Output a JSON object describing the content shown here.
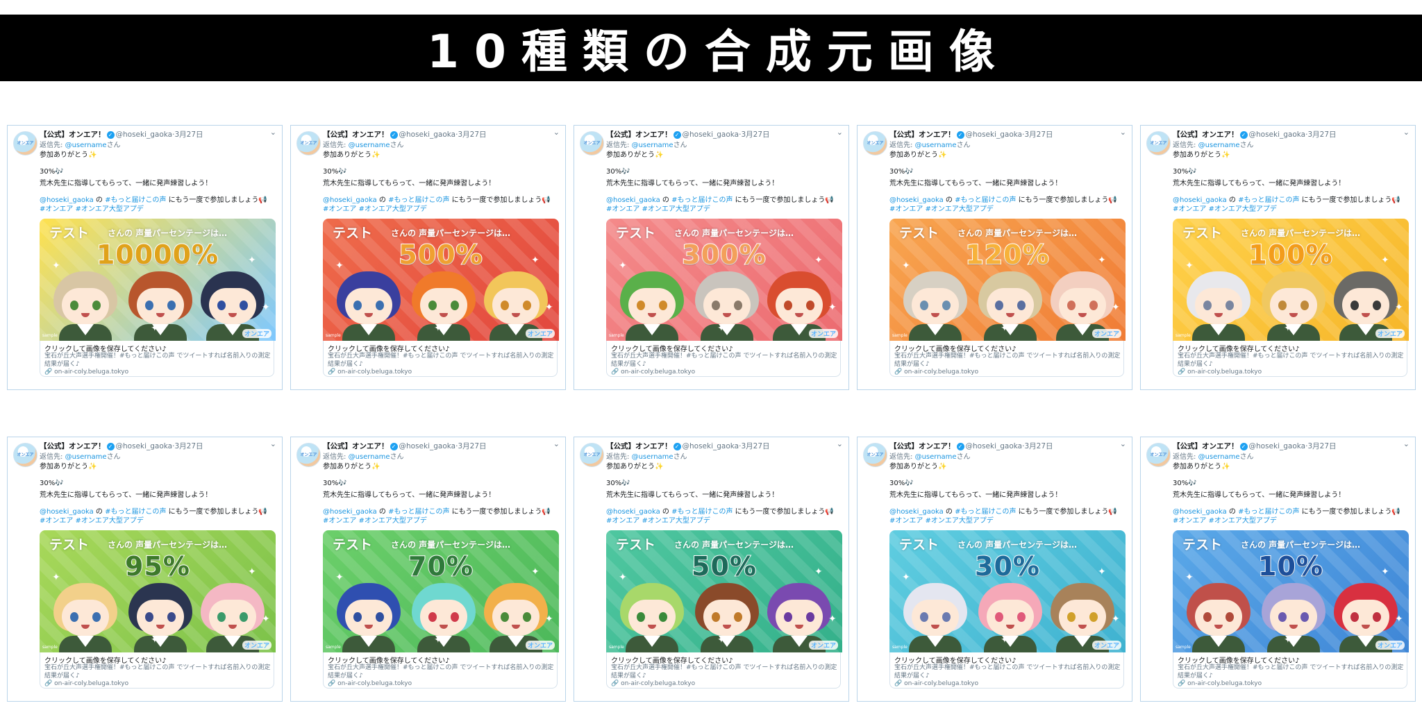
{
  "banner": {
    "title": "10種類の合成元画像"
  },
  "tweet": {
    "display_name": "【公式】オンエア！",
    "verified_glyph": "✓",
    "handle": "@hoseki_gaoka",
    "separator": "·",
    "date": "3月27日",
    "menu_glyph": "⌄",
    "reply_prefix": "返信先: ",
    "reply_user": "@username",
    "reply_suffix": "さん",
    "thanks": "参加ありがとう✨",
    "percent_line": "30%🎶",
    "coach_line": "荒木先生に指導してもらって、一緒に発声練習しよう！",
    "mention": "@hoseki_gaoka",
    "mention_mid": " の ",
    "hashtag_main": "#もっと届けこの声",
    "invite": " にもう一度で参加しましょう📢",
    "hashtags": "#オンエア #オンエア大型アプデ",
    "avatar_text": "オンエア",
    "banner_test": "テスト",
    "banner_sub": "さんの 声量パーセンテージは…",
    "banner_brand": "オンエア",
    "banner_mark": "sample",
    "card_title": "クリックして画像を保存してください♪",
    "card_desc": "宝石が丘大声選手権開催！#もっと届けこの声 でツイートすれば名前入りの測定結果が届く♪",
    "card_link": "🔗 on-air-coly.beluga.tokyo"
  },
  "cards": [
    {
      "percent": "10000%",
      "bg_from": "#ffe14d",
      "bg_to": "#7ec8ff",
      "pct_color": "#e0a21a",
      "hairs": [
        "#d8c6a4",
        "#b8562d",
        "#2a3350"
      ],
      "eyes": [
        "#4a8b3a",
        "#3b6fb0",
        "#2f4fa0"
      ]
    },
    {
      "percent": "500%",
      "bg_from": "#ef6b4a",
      "bg_to": "#e2473e",
      "pct_color": "#f0a030",
      "hairs": [
        "#3a3f9e",
        "#f07a2a",
        "#f2c65a"
      ],
      "eyes": [
        "#3b6fb0",
        "#4a8b3a",
        "#d08a2a"
      ]
    },
    {
      "percent": "300%",
      "bg_from": "#f48a8a",
      "bg_to": "#ec6b70",
      "pct_color": "#f3a05a",
      "hairs": [
        "#5ab04a",
        "#c9c4bd",
        "#d94d2f"
      ],
      "eyes": [
        "#d08a2a",
        "#8a7a6a",
        "#c04a2a"
      ]
    },
    {
      "percent": "120%",
      "bg_from": "#f8a54f",
      "bg_to": "#f07c36",
      "pct_color": "#f7b23a",
      "hairs": [
        "#d7d0c3",
        "#d8c9a0",
        "#f3cfc0"
      ],
      "eyes": [
        "#6a8fb0",
        "#5a6fa0",
        "#d0705a"
      ]
    },
    {
      "percent": "100%",
      "bg_from": "#ffd14a",
      "bg_to": "#f6b62a",
      "pct_color": "#f39c1a",
      "hairs": [
        "#e8e8ec",
        "#f0c860",
        "#6b6a66"
      ],
      "eyes": [
        "#7a86a0",
        "#c08a3a",
        "#3a3a3a"
      ]
    },
    {
      "percent": "95%",
      "bg_from": "#a8d85a",
      "bg_to": "#7cc24a",
      "pct_color": "#3d7a2a",
      "hairs": [
        "#f2d08a",
        "#2b3550",
        "#f4b8c4"
      ],
      "eyes": [
        "#3b6fb0",
        "#3a4a8a",
        "#3a9a6a"
      ]
    },
    {
      "percent": "70%",
      "bg_from": "#6ccf6a",
      "bg_to": "#4cb85a",
      "pct_color": "#2f7a3a",
      "hairs": [
        "#2f4fb0",
        "#6fd8d0",
        "#f2b04a"
      ],
      "eyes": [
        "#2f4fa0",
        "#d03a4a",
        "#4a8b3a"
      ]
    },
    {
      "percent": "50%",
      "bg_from": "#4fc7a0",
      "bg_to": "#34b08a",
      "pct_color": "#1d6a5a",
      "hairs": [
        "#a8d86a",
        "#8a4a2a",
        "#7a4ab0"
      ],
      "eyes": [
        "#3a8a3a",
        "#c07a2a",
        "#6a3aa0"
      ]
    },
    {
      "percent": "30%",
      "bg_from": "#5fcde0",
      "bg_to": "#3fb2d0",
      "pct_color": "#1d6a9a",
      "hairs": [
        "#e4e6f0",
        "#f5a8b8",
        "#a8825a"
      ],
      "eyes": [
        "#6a7ab0",
        "#e05a7a",
        "#d0a02a"
      ]
    },
    {
      "percent": "10%",
      "bg_from": "#5aa8e8",
      "bg_to": "#3f86d6",
      "pct_color": "#1d4f9a",
      "hairs": [
        "#c0504a",
        "#a8a4d8",
        "#d83040"
      ],
      "eyes": [
        "#b04a3a",
        "#6a5ab0",
        "#c03040"
      ]
    }
  ]
}
